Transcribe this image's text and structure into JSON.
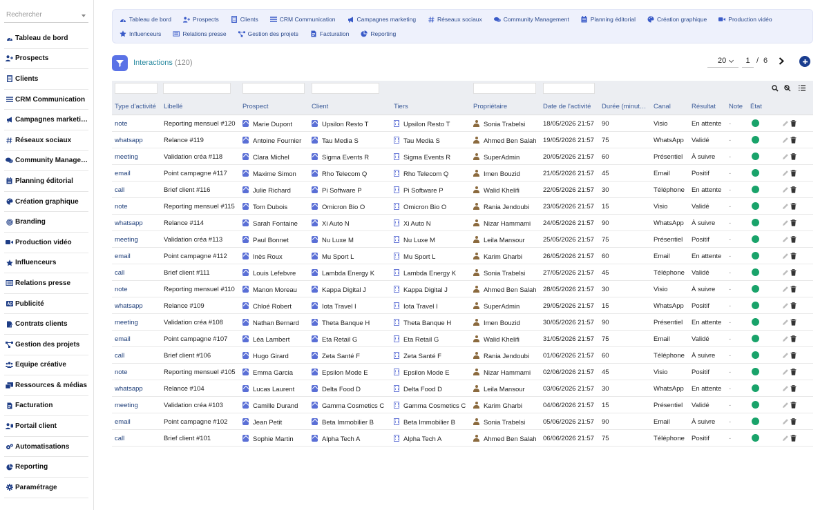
{
  "colors": {
    "accent": "#5a72e6",
    "brand_dark": "#1a3d8f",
    "title": "#2a8aa0",
    "status_ok": "#19a36a",
    "nav_bg": "#eef1fc"
  },
  "sidebar": {
    "search_placeholder": "Rechercher",
    "items": [
      {
        "label": "Tableau de bord",
        "icon": "dashboard-icon"
      },
      {
        "label": "Prospects",
        "icon": "user-plus-icon"
      },
      {
        "label": "Clients",
        "icon": "building-icon"
      },
      {
        "label": "CRM Communication",
        "icon": "list-icon"
      },
      {
        "label": "Campagnes marketing",
        "icon": "megaphone-icon"
      },
      {
        "label": "Réseaux sociaux",
        "icon": "hashtag-icon"
      },
      {
        "label": "Community Management",
        "icon": "comments-icon"
      },
      {
        "label": "Planning éditorial",
        "icon": "calendar-icon"
      },
      {
        "label": "Création graphique",
        "icon": "palette-icon"
      },
      {
        "label": "Branding",
        "icon": "fingerprint-icon"
      },
      {
        "label": "Production vidéo",
        "icon": "video-icon"
      },
      {
        "label": "Influenceurs",
        "icon": "star-icon"
      },
      {
        "label": "Relations presse",
        "icon": "newspaper-icon"
      },
      {
        "label": "Publicité",
        "icon": "ad-icon"
      },
      {
        "label": "Contrats clients",
        "icon": "contract-icon"
      },
      {
        "label": "Gestion des projets",
        "icon": "project-diagram-icon"
      },
      {
        "label": "Équipe créative",
        "icon": "team-icon"
      },
      {
        "label": "Ressources & médias",
        "icon": "photo-video-icon"
      },
      {
        "label": "Facturation",
        "icon": "invoice-icon"
      },
      {
        "label": "Portail client",
        "icon": "portal-icon"
      },
      {
        "label": "Automatisations",
        "icon": "cogs-icon"
      },
      {
        "label": "Reporting",
        "icon": "chart-pie-icon"
      },
      {
        "label": "Paramétrage",
        "icon": "gear-icon"
      }
    ]
  },
  "topnav": {
    "row1": [
      {
        "label": "Tableau de bord",
        "icon": "dashboard-icon"
      },
      {
        "label": "Prospects",
        "icon": "user-plus-icon"
      },
      {
        "label": "Clients",
        "icon": "building-icon"
      },
      {
        "label": "CRM Communication",
        "icon": "list-icon"
      },
      {
        "label": "Campagnes marketing",
        "icon": "megaphone-icon"
      },
      {
        "label": "Réseaux sociaux",
        "icon": "hashtag-icon"
      },
      {
        "label": "Community Management",
        "icon": "comments-icon"
      },
      {
        "label": "Planning éditorial",
        "icon": "calendar-icon"
      },
      {
        "label": "Création graphique",
        "icon": "palette-icon"
      },
      {
        "label": "Production vidéo",
        "icon": "video-icon"
      }
    ],
    "row2": [
      {
        "label": "Influenceurs",
        "icon": "star-icon"
      },
      {
        "label": "Relations presse",
        "icon": "newspaper-icon"
      },
      {
        "label": "Gestion des projets",
        "icon": "project-diagram-icon"
      },
      {
        "label": "Facturation",
        "icon": "invoice-icon"
      },
      {
        "label": "Reporting",
        "icon": "chart-pie-icon"
      }
    ]
  },
  "header": {
    "title": "Interactions",
    "count": "(120)",
    "per_page": "20",
    "page": "1",
    "page_sep": "/",
    "page_total": "6"
  },
  "table": {
    "columns": [
      "Type d'activité",
      "Libellé",
      "Prospect",
      "Client",
      "Tiers",
      "Propriétaire",
      "Date de l'activité",
      "Durée (minut…",
      "Canal",
      "Résultat",
      "Note",
      "État"
    ],
    "rows": [
      [
        "note",
        "Reporting mensuel #120",
        "Marie Dupont",
        "Upsilon Resto T",
        "Upsilon Resto T",
        "Sonia Trabelsi",
        "18/05/2026 21:57",
        "90",
        "Visio",
        "En attente",
        "-"
      ],
      [
        "whatsapp",
        "Relance #119",
        "Antoine Fournier",
        "Tau Media S",
        "Tau Media S",
        "Ahmed Ben Salah",
        "19/05/2026 21:57",
        "75",
        "WhatsApp",
        "Validé",
        "-"
      ],
      [
        "meeting",
        "Validation créa #118",
        "Clara Michel",
        "Sigma Events R",
        "Sigma Events R",
        "SuperAdmin",
        "20/05/2026 21:57",
        "60",
        "Présentiel",
        "À suivre",
        "-"
      ],
      [
        "email",
        "Point campagne #117",
        "Maxime Simon",
        "Rho Telecom Q",
        "Rho Telecom Q",
        "Imen Bouzid",
        "21/05/2026 21:57",
        "45",
        "Email",
        "Positif",
        "-"
      ],
      [
        "call",
        "Brief client #116",
        "Julie Richard",
        "Pi Software P",
        "Pi Software P",
        "Walid Khelifi",
        "22/05/2026 21:57",
        "30",
        "Téléphone",
        "En attente",
        "-"
      ],
      [
        "note",
        "Reporting mensuel #115",
        "Tom Dubois",
        "Omicron Bio O",
        "Omicron Bio O",
        "Rania Jendoubi",
        "23/05/2026 21:57",
        "15",
        "Visio",
        "Validé",
        "-"
      ],
      [
        "whatsapp",
        "Relance #114",
        "Sarah Fontaine",
        "Xi Auto N",
        "Xi Auto N",
        "Nizar Hammami",
        "24/05/2026 21:57",
        "90",
        "WhatsApp",
        "À suivre",
        "-"
      ],
      [
        "meeting",
        "Validation créa #113",
        "Paul Bonnet",
        "Nu Luxe M",
        "Nu Luxe M",
        "Leila Mansour",
        "25/05/2026 21:57",
        "75",
        "Présentiel",
        "Positif",
        "-"
      ],
      [
        "email",
        "Point campagne #112",
        "Inès Roux",
        "Mu Sport L",
        "Mu Sport L",
        "Karim Gharbi",
        "26/05/2026 21:57",
        "60",
        "Email",
        "En attente",
        "-"
      ],
      [
        "call",
        "Brief client #111",
        "Louis Lefebvre",
        "Lambda Energy K",
        "Lambda Energy K",
        "Sonia Trabelsi",
        "27/05/2026 21:57",
        "45",
        "Téléphone",
        "Validé",
        "-"
      ],
      [
        "note",
        "Reporting mensuel #110",
        "Manon Moreau",
        "Kappa Digital J",
        "Kappa Digital J",
        "Ahmed Ben Salah",
        "28/05/2026 21:57",
        "30",
        "Visio",
        "À suivre",
        "-"
      ],
      [
        "whatsapp",
        "Relance #109",
        "Chloé Robert",
        "Iota Travel I",
        "Iota Travel I",
        "SuperAdmin",
        "29/05/2026 21:57",
        "15",
        "WhatsApp",
        "Positif",
        "-"
      ],
      [
        "meeting",
        "Validation créa #108",
        "Nathan Bernard",
        "Theta Banque H",
        "Theta Banque H",
        "Imen Bouzid",
        "30/05/2026 21:57",
        "90",
        "Présentiel",
        "En attente",
        "-"
      ],
      [
        "email",
        "Point campagne #107",
        "Léa Lambert",
        "Eta Retail G",
        "Eta Retail G",
        "Walid Khelifi",
        "31/05/2026 21:57",
        "75",
        "Email",
        "Validé",
        "-"
      ],
      [
        "call",
        "Brief client #106",
        "Hugo Girard",
        "Zeta Santé F",
        "Zeta Santé F",
        "Rania Jendoubi",
        "01/06/2026 21:57",
        "60",
        "Téléphone",
        "À suivre",
        "-"
      ],
      [
        "note",
        "Reporting mensuel #105",
        "Emma Garcia",
        "Epsilon Mode E",
        "Epsilon Mode E",
        "Nizar Hammami",
        "02/06/2026 21:57",
        "45",
        "Visio",
        "Positif",
        "-"
      ],
      [
        "whatsapp",
        "Relance #104",
        "Lucas Laurent",
        "Delta Food D",
        "Delta Food D",
        "Leila Mansour",
        "03/06/2026 21:57",
        "30",
        "WhatsApp",
        "En attente",
        "-"
      ],
      [
        "meeting",
        "Validation créa #103",
        "Camille Durand",
        "Gamma Cosmetics C",
        "Gamma Cosmetics C",
        "Karim Gharbi",
        "04/06/2026 21:57",
        "15",
        "Présentiel",
        "Validé",
        "-"
      ],
      [
        "email",
        "Point campagne #102",
        "Jean Petit",
        "Beta Immobilier B",
        "Beta Immobilier B",
        "Sonia Trabelsi",
        "05/06/2026 21:57",
        "90",
        "Email",
        "À suivre",
        "-"
      ],
      [
        "call",
        "Brief client #101",
        "Sophie Martin",
        "Alpha Tech A",
        "Alpha Tech A",
        "Ahmed Ben Salah",
        "06/06/2026 21:57",
        "75",
        "Téléphone",
        "Positif",
        "-"
      ]
    ]
  }
}
